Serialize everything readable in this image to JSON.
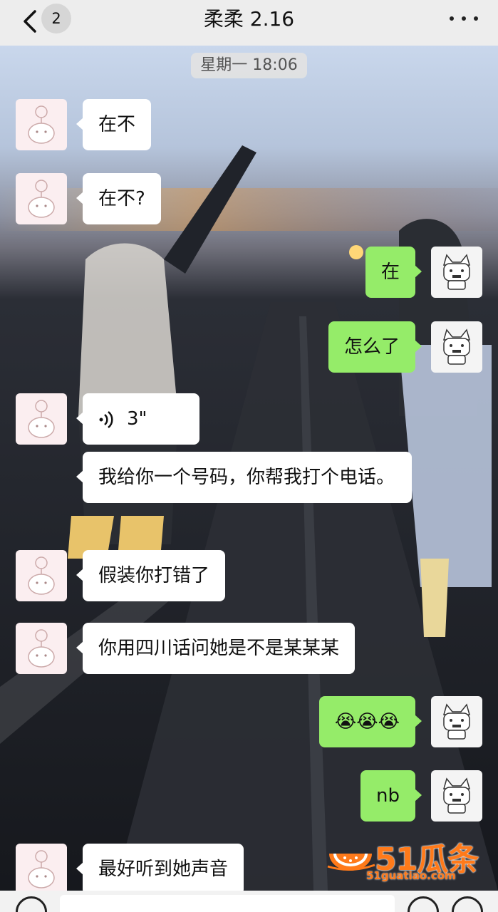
{
  "header": {
    "unread_count": "2",
    "title": "柔柔 2.16"
  },
  "timestamp": "星期一 18:06",
  "messages": [
    {
      "side": "in",
      "text": "在不"
    },
    {
      "side": "in",
      "text": "在不?"
    },
    {
      "side": "out",
      "text": "在"
    },
    {
      "side": "out",
      "text": "怎么了"
    },
    {
      "side": "in",
      "type": "voice",
      "duration": "3\""
    },
    {
      "side": "in",
      "text": "我给你一个号码，你帮我打个电话。"
    },
    {
      "side": "in",
      "text": "假装你打错了"
    },
    {
      "side": "in",
      "text": "你用四川话问她是不是某某某"
    },
    {
      "side": "out",
      "text": "😭😭😭"
    },
    {
      "side": "out",
      "text": "nb"
    },
    {
      "side": "in",
      "text": "最好听到她声音"
    }
  ],
  "watermark": {
    "brand": "51瓜条",
    "url": "51guatiao.com"
  },
  "input": {
    "placeholder": ""
  },
  "colors": {
    "outgoing_bubble": "#95ec69",
    "incoming_bubble": "#ffffff",
    "header_bg": "#ededed",
    "watermark": "#ff7a1a"
  }
}
